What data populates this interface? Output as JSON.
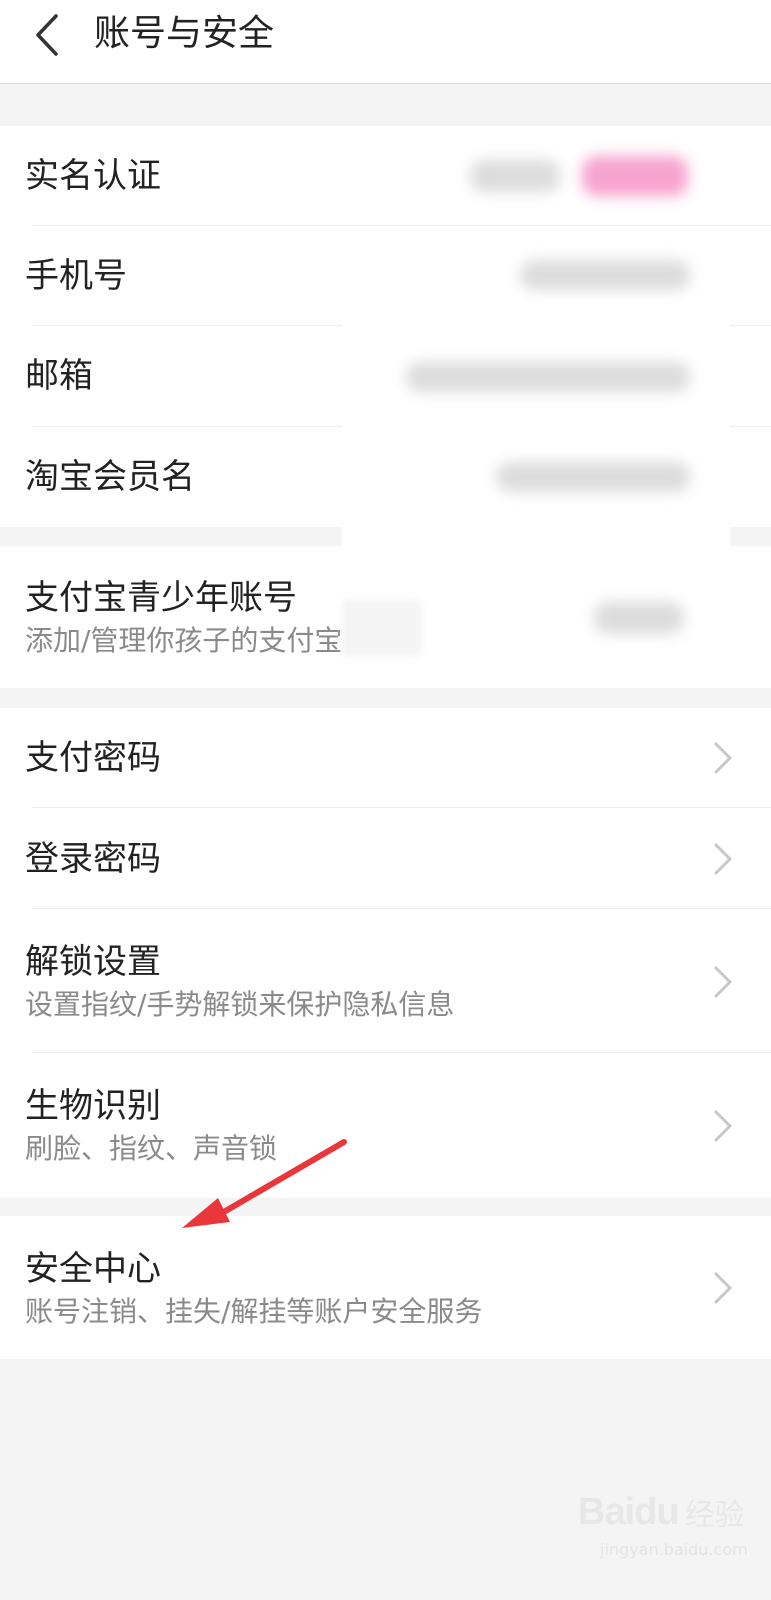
{
  "header": {
    "title": "账号与安全",
    "back_icon": "chevron-left-icon"
  },
  "groups": [
    {
      "items": [
        {
          "title": "实名认证",
          "value": "已认证（已模糊）"
        },
        {
          "title": "手机号",
          "value": "已模糊"
        },
        {
          "title": "邮箱",
          "value": "已模糊"
        },
        {
          "title": "淘宝会员名",
          "value": "已模糊"
        }
      ]
    },
    {
      "items": [
        {
          "title": "支付宝青少年账号",
          "subtitle": "添加/管理你孩子的支付宝"
        }
      ]
    },
    {
      "items": [
        {
          "title": "支付密码"
        },
        {
          "title": "登录密码"
        },
        {
          "title": "解锁设置",
          "subtitle": "设置指纹/手势解锁来保护隐私信息"
        },
        {
          "title": "生物识别",
          "subtitle": "刷脸、指纹、声音锁"
        }
      ]
    },
    {
      "items": [
        {
          "title": "安全中心",
          "subtitle": "账号注销、挂失/解挂等账户安全服务"
        }
      ]
    }
  ],
  "annotation": {
    "arrow_color": "#e8373a"
  },
  "watermark": {
    "logo": "Baidu",
    "text": "经验",
    "url": "jingyan.baidu.com"
  },
  "colors": {
    "background": "#f4f4f4",
    "card": "#ffffff",
    "text_primary": "#222222",
    "text_secondary": "#8a8a8a",
    "chevron": "#c7c7c7"
  }
}
